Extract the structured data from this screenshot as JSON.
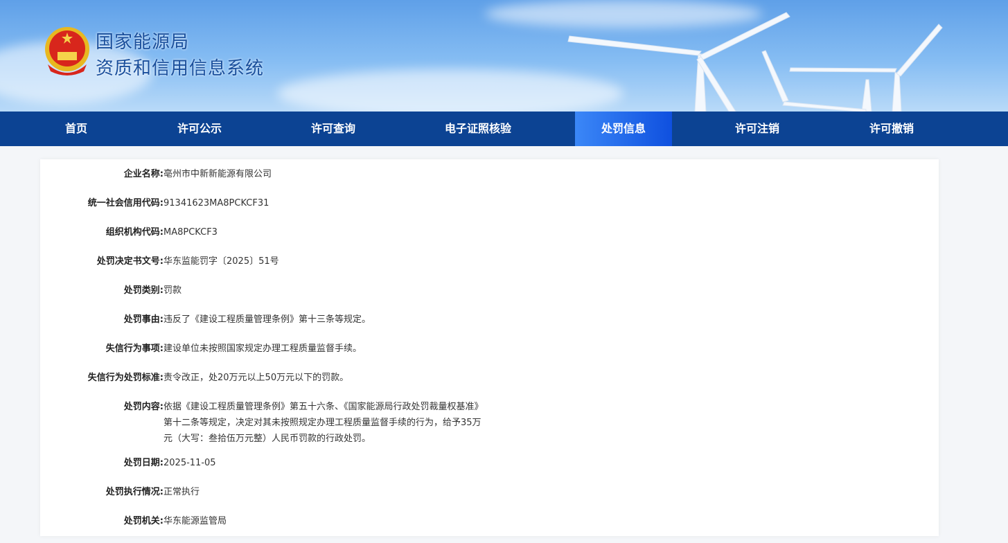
{
  "header": {
    "title_line1": "国家能源局",
    "title_line2": "资质和信用信息系统"
  },
  "nav": [
    {
      "label": "首页",
      "active": false
    },
    {
      "label": "许可公示",
      "active": false
    },
    {
      "label": "许可查询",
      "active": false
    },
    {
      "label": "电子证照核验",
      "active": false
    },
    {
      "label": "处罚信息",
      "active": true
    },
    {
      "label": "许可注销",
      "active": false
    },
    {
      "label": "许可撤销",
      "active": false
    }
  ],
  "fields": [
    {
      "label": "企业名称:",
      "value": "亳州市中新新能源有限公司"
    },
    {
      "label": "统一社会信用代码:",
      "value": "91341623MA8PCKCF31"
    },
    {
      "label": "组织机构代码:",
      "value": "MA8PCKCF3"
    },
    {
      "label": "处罚决定书文号:",
      "value": "华东监能罚字〔2025〕51号"
    },
    {
      "label": "处罚类别:",
      "value": "罚款"
    },
    {
      "label": "处罚事由:",
      "value": "违反了《建设工程质量管理条例》第十三条等规定。"
    },
    {
      "label": "失信行为事项:",
      "value": "建设单位未按照国家规定办理工程质量监督手续。"
    },
    {
      "label": "失信行为处罚标准:",
      "value": "责令改正，处20万元以上50万元以下的罚款。"
    },
    {
      "label": "处罚内容:",
      "value": "依据《建设工程质量管理条例》第五十六条、《国家能源局行政处罚裁量权基准》第十二条等规定，决定对其未按照规定办理工程质量监督手续的行为，给予35万元（大写：叁拾伍万元整）人民币罚款的行政处罚。"
    },
    {
      "label": "处罚日期:",
      "value": "2025-11-05"
    },
    {
      "label": "处罚执行情况:",
      "value": "正常执行"
    },
    {
      "label": "处罚机关:",
      "value": "华东能源监管局"
    }
  ]
}
